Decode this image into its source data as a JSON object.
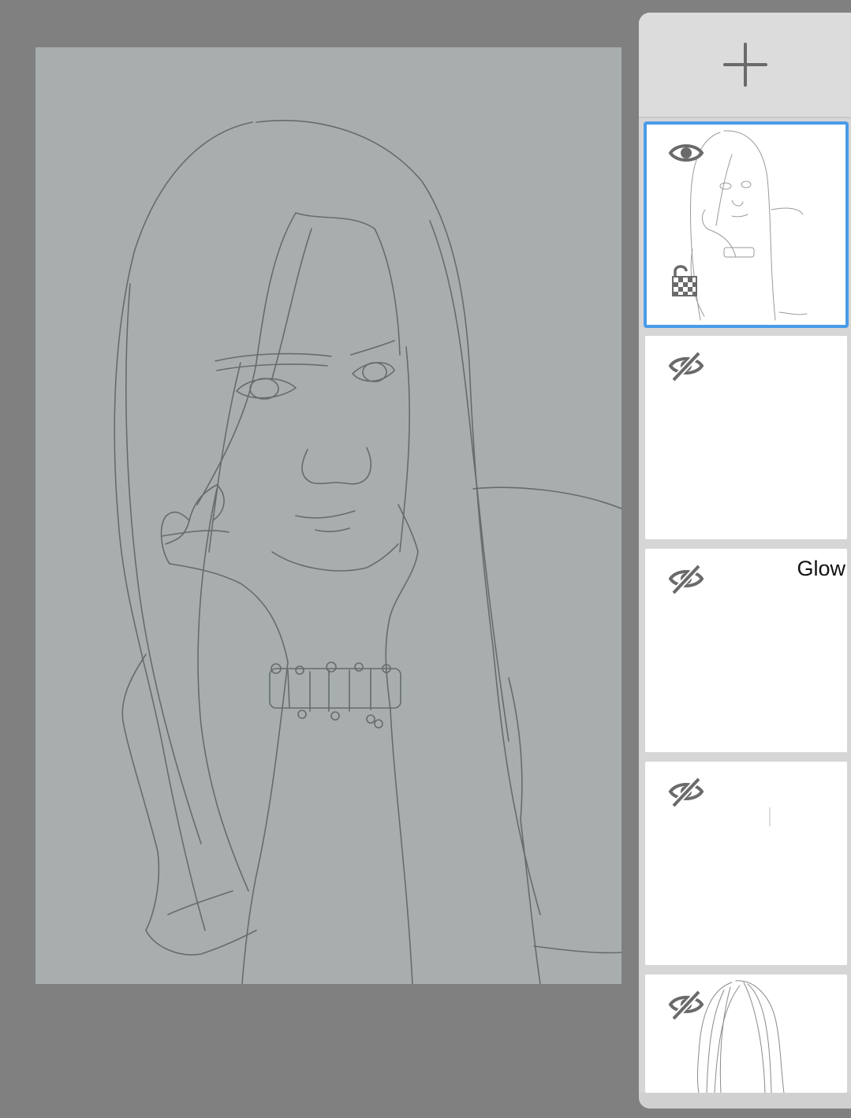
{
  "canvas": {
    "background": "#a8aeae",
    "artwork": "line-drawing-portrait"
  },
  "layers_panel": {
    "add_button_icon": "plus-icon",
    "accent": "#4a9be8",
    "layers": [
      {
        "name": "",
        "visible": true,
        "selected": true,
        "locked_alpha": true,
        "thumbnail": "full-sketch"
      },
      {
        "name": "",
        "visible": false,
        "selected": false,
        "locked_alpha": false,
        "thumbnail": "empty"
      },
      {
        "name": "Glow",
        "visible": false,
        "selected": false,
        "locked_alpha": false,
        "thumbnail": "empty"
      },
      {
        "name": "",
        "visible": false,
        "selected": false,
        "locked_alpha": false,
        "thumbnail": "faint-mark"
      },
      {
        "name": "",
        "visible": false,
        "selected": false,
        "locked_alpha": false,
        "thumbnail": "hair-sketch"
      }
    ]
  }
}
